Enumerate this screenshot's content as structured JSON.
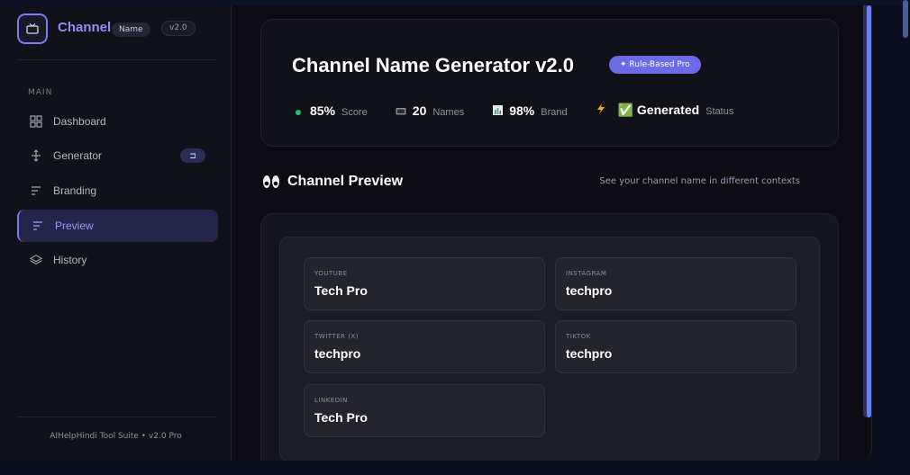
{
  "brand": {
    "title": "Channel",
    "pill": "Name",
    "version": "v2.0"
  },
  "sidebar": {
    "section": "MAIN",
    "items": [
      {
        "label": "Dashboard",
        "icon": "grid-icon"
      },
      {
        "label": "Generator",
        "icon": "move-icon",
        "badge": "⊐"
      },
      {
        "label": "Branding",
        "icon": "lines-icon"
      },
      {
        "label": "Preview",
        "icon": "lines-icon",
        "active": true
      },
      {
        "label": "History",
        "icon": "layers-icon"
      }
    ],
    "footer": "AIHelpHindi Tool Suite • v2.0 Pro"
  },
  "header": {
    "title": "Channel Name Generator v2.0",
    "pill": "✦ Rule-Based Pro",
    "stats": [
      {
        "icon": "green-dot-icon",
        "value": "85%",
        "label": "Score"
      },
      {
        "icon": "tv-icon",
        "value": "20",
        "label": "Names"
      },
      {
        "icon": "bar-chart-icon",
        "value": "98%",
        "label": "Brand"
      },
      {
        "icon": "lightning-icon",
        "value": "✅ Generated",
        "label": "Status"
      }
    ]
  },
  "preview": {
    "title": "Channel Preview",
    "subtitle": "See your channel name in different contexts",
    "platforms": [
      {
        "platform": "YOUTUBE",
        "name": "Tech Pro"
      },
      {
        "platform": "INSTAGRAM",
        "name": "techpro"
      },
      {
        "platform": "TWITTER (X)",
        "name": "techpro"
      },
      {
        "platform": "TIKTOK",
        "name": "techpro"
      },
      {
        "platform": "LINKEDIN",
        "name": "Tech Pro"
      }
    ]
  },
  "colors": {
    "accent": "#7b7cf0",
    "background": "#0c0c12",
    "card": "#111219"
  }
}
